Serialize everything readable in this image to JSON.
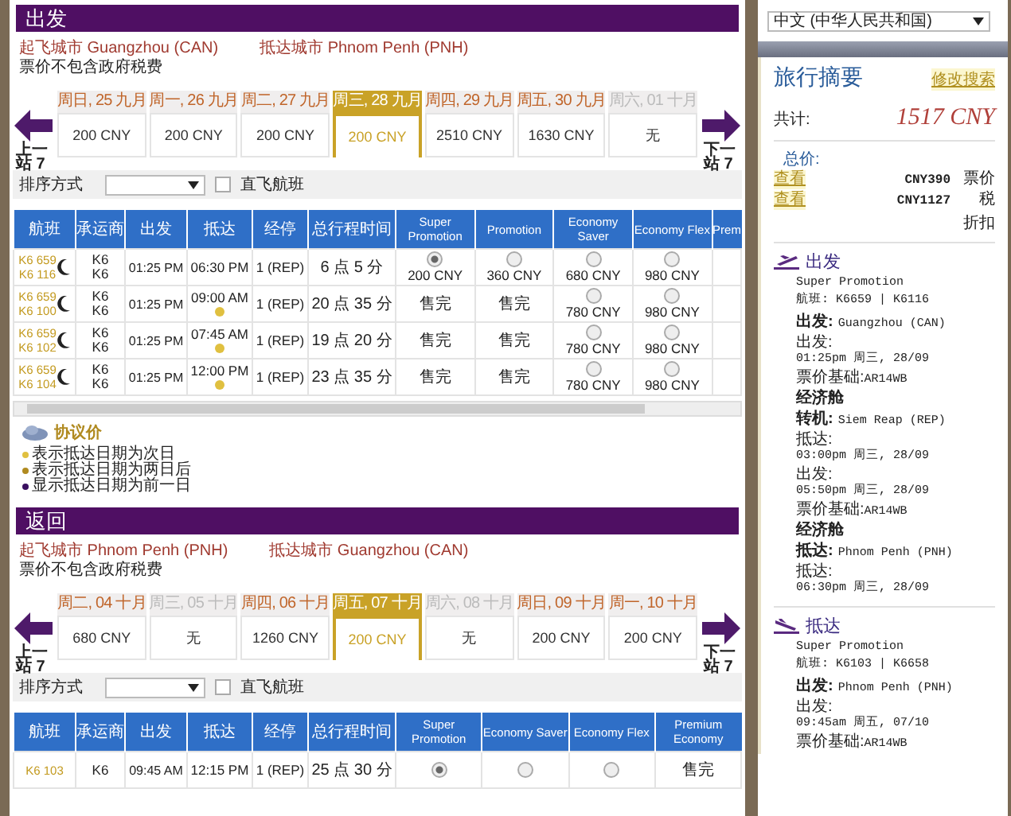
{
  "outbound": {
    "title": "出发",
    "origin": "起飞城市 Guangzhou (CAN)",
    "destination": "抵达城市 Phnom Penh (PNH)",
    "note": "票价不包含政府税费",
    "prev_label": "上一站 7",
    "next_label": "下一站 7",
    "dates": [
      {
        "day": "周日, 25 九月",
        "price": "200 CNY",
        "selected": false,
        "disabled": false
      },
      {
        "day": "周一, 26 九月",
        "price": "200 CNY",
        "selected": false,
        "disabled": false
      },
      {
        "day": "周二, 27 九月",
        "price": "200 CNY",
        "selected": false,
        "disabled": false
      },
      {
        "day": "周三, 28 九月",
        "price": "200 CNY",
        "selected": true,
        "disabled": false
      },
      {
        "day": "周四, 29 九月",
        "price": "2510 CNY",
        "selected": false,
        "disabled": false
      },
      {
        "day": "周五, 30 九月",
        "price": "1630 CNY",
        "selected": false,
        "disabled": false
      },
      {
        "day": "周六, 01 十月",
        "price": "无",
        "selected": false,
        "disabled": true
      }
    ],
    "sort": {
      "label": "排序方式"
    },
    "direct_only": {
      "label": "直飞航班",
      "checked": false
    },
    "table": {
      "columns": [
        {
          "label": "航班",
          "kind": "info"
        },
        {
          "label": "承运商",
          "kind": "info"
        },
        {
          "label": "出发",
          "kind": "info"
        },
        {
          "label": "抵达",
          "kind": "info"
        },
        {
          "label": "经停",
          "kind": "info"
        },
        {
          "label": "总行程时间",
          "kind": "info"
        },
        {
          "label": "Super Promotion",
          "kind": "fare"
        },
        {
          "label": "Promotion",
          "kind": "fare"
        },
        {
          "label": "Economy Saver",
          "kind": "fare"
        },
        {
          "label": "Economy Flex",
          "kind": "fare"
        },
        {
          "label": "Prem",
          "kind": "partial"
        }
      ],
      "rows": [
        {
          "flights": "K6 659\nK6 116",
          "overnight": true,
          "carriers": "K6\nK6",
          "depart": "01:25 PM",
          "arrive": "06:30 PM",
          "next_day": false,
          "stops": "1 (REP)",
          "duration": "6 点 5 分",
          "fares": [
            {
              "kind": "radio",
              "selected": true,
              "price": "200 CNY"
            },
            {
              "kind": "radio",
              "selected": false,
              "price": "360 CNY"
            },
            {
              "kind": "radio",
              "selected": false,
              "price": "680 CNY"
            },
            {
              "kind": "radio",
              "selected": false,
              "price": "980 CNY"
            }
          ]
        },
        {
          "flights": "K6 659\nK6 100",
          "overnight": true,
          "carriers": "K6\nK6",
          "depart": "01:25 PM",
          "arrive": "09:00 AM",
          "next_day": true,
          "stops": "1 (REP)",
          "duration": "20 点 35 分",
          "fares": [
            {
              "kind": "soldout",
              "text": "售完"
            },
            {
              "kind": "soldout",
              "text": "售完"
            },
            {
              "kind": "radio",
              "selected": false,
              "price": "780 CNY"
            },
            {
              "kind": "radio",
              "selected": false,
              "price": "980 CNY"
            }
          ]
        },
        {
          "flights": "K6 659\nK6 102",
          "overnight": true,
          "carriers": "K6\nK6",
          "depart": "01:25 PM",
          "arrive": "07:45 AM",
          "next_day": true,
          "stops": "1 (REP)",
          "duration": "19 点 20 分",
          "fares": [
            {
              "kind": "soldout",
              "text": "售完"
            },
            {
              "kind": "soldout",
              "text": "售完"
            },
            {
              "kind": "radio",
              "selected": false,
              "price": "780 CNY"
            },
            {
              "kind": "radio",
              "selected": false,
              "price": "980 CNY"
            }
          ]
        },
        {
          "flights": "K6 659\nK6 104",
          "overnight": true,
          "carriers": "K6\nK6",
          "depart": "01:25 PM",
          "arrive": "12:00 PM",
          "next_day": true,
          "stops": "1 (REP)",
          "duration": "23 点 35 分",
          "fares": [
            {
              "kind": "soldout",
              "text": "售完"
            },
            {
              "kind": "soldout",
              "text": "售完"
            },
            {
              "kind": "radio",
              "selected": false,
              "price": "780 CNY"
            },
            {
              "kind": "radio",
              "selected": false,
              "price": "980 CNY"
            }
          ]
        }
      ]
    },
    "legend": {
      "title": "协议价",
      "notes": [
        {
          "text": "表示抵达日期为次日",
          "color": "#e0c040"
        },
        {
          "text": "表示抵达日期为两日后",
          "color": "#b08a20"
        },
        {
          "text": "显示抵达日期为前一日",
          "color": "#3a1060"
        }
      ]
    }
  },
  "return": {
    "title": "返回",
    "origin": "起飞城市 Phnom Penh (PNH)",
    "destination": "抵达城市 Guangzhou (CAN)",
    "note": "票价不包含政府税费",
    "prev_label": "上一站 7",
    "next_label": "下一站 7",
    "dates": [
      {
        "day": "周二, 04 十月",
        "price": "680 CNY",
        "selected": false,
        "disabled": false
      },
      {
        "day": "周三, 05 十月",
        "price": "无",
        "selected": false,
        "disabled": true
      },
      {
        "day": "周四, 06 十月",
        "price": "1260 CNY",
        "selected": false,
        "disabled": false
      },
      {
        "day": "周五, 07 十月",
        "price": "200 CNY",
        "selected": true,
        "disabled": false
      },
      {
        "day": "周六, 08 十月",
        "price": "无",
        "selected": false,
        "disabled": true
      },
      {
        "day": "周日, 09 十月",
        "price": "200 CNY",
        "selected": false,
        "disabled": false
      },
      {
        "day": "周一, 10 十月",
        "price": "200 CNY",
        "selected": false,
        "disabled": false
      }
    ],
    "sort": {
      "label": "排序方式"
    },
    "direct_only": {
      "label": "直飞航班",
      "checked": false
    },
    "table": {
      "columns": [
        {
          "label": "航班",
          "kind": "info"
        },
        {
          "label": "承运商",
          "kind": "info"
        },
        {
          "label": "出发",
          "kind": "info"
        },
        {
          "label": "抵达",
          "kind": "info"
        },
        {
          "label": "经停",
          "kind": "info"
        },
        {
          "label": "总行程时间",
          "kind": "info"
        },
        {
          "label": "Super Promotion",
          "kind": "fare"
        },
        {
          "label": "Economy Saver",
          "kind": "fare"
        },
        {
          "label": "Economy Flex",
          "kind": "fare"
        },
        {
          "label": "Premium Economy",
          "kind": "fare"
        }
      ],
      "rows": [
        {
          "flights": "K6 103",
          "overnight": false,
          "carriers": "K6",
          "depart": "09:45 AM",
          "arrive": "12:15 PM",
          "next_day": false,
          "stops": "1 (REP)",
          "duration": "25 点 30 分",
          "fares": [
            {
              "kind": "radio",
              "selected": true
            },
            {
              "kind": "radio",
              "selected": false
            },
            {
              "kind": "radio",
              "selected": false
            },
            {
              "kind": "soldout",
              "text": "售完"
            }
          ]
        }
      ]
    }
  },
  "sidebar": {
    "language": "中文 (中华人民共和国)",
    "title": "旅行摘要",
    "edit_link": "修改搜索",
    "total_label": "共计:",
    "total": "1517 CNY",
    "price_label": "总价:",
    "price_rows": [
      {
        "link": "查看",
        "amount": "CNY390",
        "label": "票价"
      },
      {
        "link": "查看",
        "amount": "CNY1127",
        "label": "税"
      }
    ],
    "discount_label": "折扣",
    "segments": [
      {
        "kind": "takeoff",
        "title": "出发",
        "fare_class": "Super Promotion",
        "flight": "航班: K6659 | K6116",
        "details": [
          {
            "kind": "place",
            "label": "出发:",
            "value": "Guangzhou (CAN)"
          },
          {
            "kind": "time",
            "label": "出发:",
            "value": "01:25pm 周三, 28/09"
          },
          {
            "kind": "basis",
            "label": "票价基础:",
            "value": "AR14WB"
          },
          {
            "kind": "cabin",
            "label": "经济舱"
          },
          {
            "kind": "place",
            "label": "转机:",
            "value": "Siem Reap (REP)"
          },
          {
            "kind": "time",
            "label": "抵达:",
            "value": "03:00pm 周三, 28/09"
          },
          {
            "kind": "time",
            "label": "出发:",
            "value": "05:50pm 周三, 28/09"
          },
          {
            "kind": "basis",
            "label": "票价基础:",
            "value": "AR14WB"
          },
          {
            "kind": "cabin",
            "label": "经济舱"
          },
          {
            "kind": "place",
            "label": "抵达:",
            "value": "Phnom Penh (PNH)"
          },
          {
            "kind": "time",
            "label": "抵达:",
            "value": "06:30pm 周三, 28/09"
          }
        ]
      },
      {
        "kind": "landing",
        "title": "抵达",
        "fare_class": "Super Promotion",
        "flight": "航班: K6103 | K6658",
        "details": [
          {
            "kind": "place",
            "label": "出发:",
            "value": "Phnom Penh (PNH)"
          },
          {
            "kind": "time",
            "label": "出发:",
            "value": "09:45am 周五, 07/10"
          },
          {
            "kind": "basis",
            "label": "票价基础:",
            "value": "AR14WB"
          }
        ]
      }
    ]
  }
}
